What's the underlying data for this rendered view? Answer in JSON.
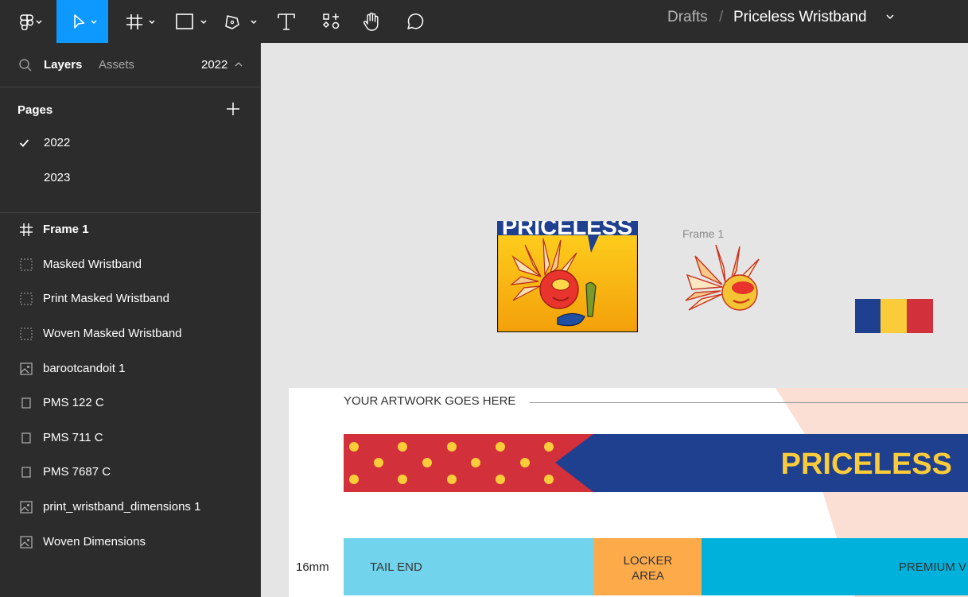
{
  "toolbar": {
    "tools": [
      "figma-menu",
      "move",
      "frame",
      "shape",
      "pen",
      "text",
      "resources",
      "hand",
      "comment"
    ]
  },
  "breadcrumb": {
    "project": "Drafts",
    "separator": "/",
    "file_name": "Priceless Wristband"
  },
  "sidebar": {
    "tabs": {
      "layers": "Layers",
      "assets": "Assets"
    },
    "page_selector": "2022",
    "pages_title": "Pages",
    "pages": [
      {
        "label": "2022",
        "selected": true
      },
      {
        "label": "2023",
        "selected": false
      }
    ],
    "layers": [
      {
        "label": "Frame 1",
        "icon": "frame-icon"
      },
      {
        "label": "Masked Wristband",
        "icon": "mask-icon"
      },
      {
        "label": "Print Masked Wristband",
        "icon": "mask-icon"
      },
      {
        "label": "Woven Masked Wristband",
        "icon": "mask-icon"
      },
      {
        "label": "barootcandoit 1",
        "icon": "image-icon"
      },
      {
        "label": "PMS 122 C",
        "icon": "rectangle-icon"
      },
      {
        "label": "PMS 711 C",
        "icon": "rectangle-icon"
      },
      {
        "label": "PMS 7687 C",
        "icon": "rectangle-icon"
      },
      {
        "label": "print_wristband_dimensions 1",
        "icon": "image-icon"
      },
      {
        "label": "Woven Dimensions",
        "icon": "image-icon"
      }
    ]
  },
  "canvas": {
    "priceless_logo_text": "PRICELESS",
    "frame_label": "Frame 1",
    "swatch_colors": [
      "#1f3f8f",
      "#fbcc3a",
      "#d2303b"
    ],
    "artwork_label": "YOUR ARTWORK GOES HERE",
    "wristband_text": "PRICELESS",
    "dimension_label": "16mm",
    "segments": {
      "tail_end": "TAIL END",
      "locker_line1": "LOCKER",
      "locker_line2": "AREA",
      "premium": "PREMIUM V"
    }
  },
  "colors": {
    "toolbar_bg": "#2c2c2c",
    "active_tool": "#0d99ff",
    "canvas_bg": "#e5e5e5",
    "brand_blue": "#1f3f8f",
    "brand_yellow": "#fbcc3a",
    "brand_red": "#d2303b",
    "tail_end": "#72d4ec",
    "locker": "#fdaa4a",
    "premium": "#00b1dc"
  }
}
